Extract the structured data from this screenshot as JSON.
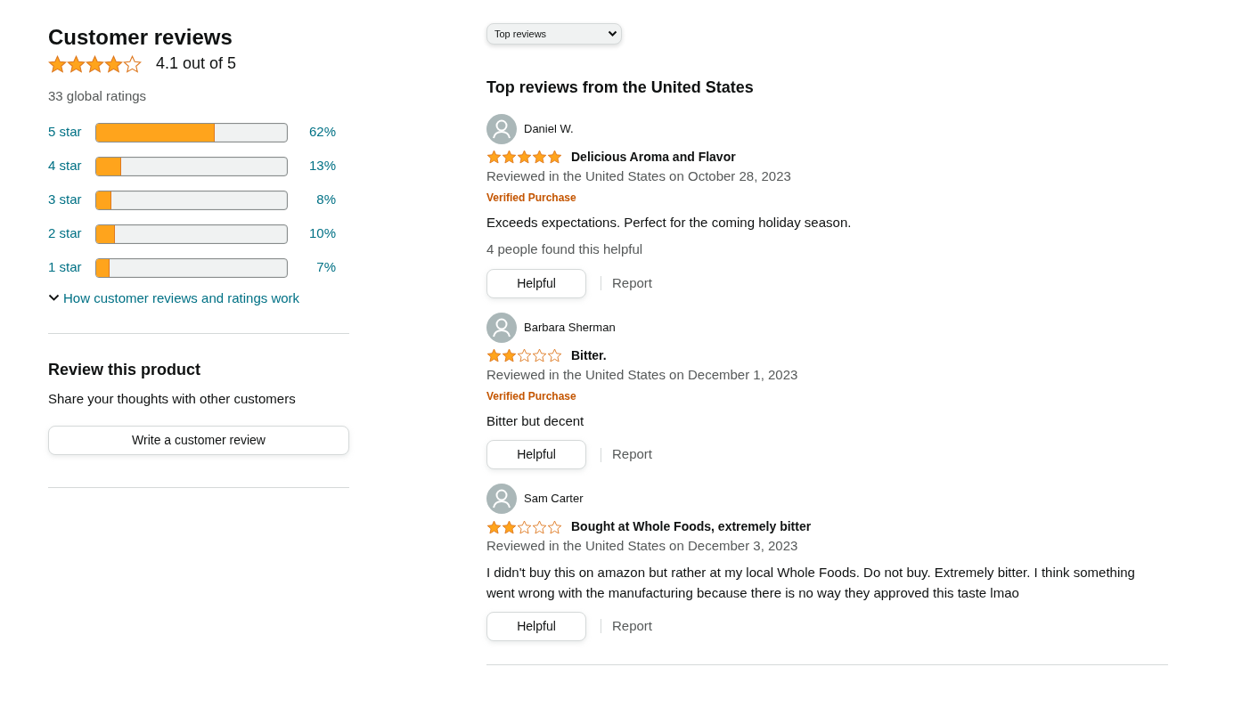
{
  "summary": {
    "title": "Customer reviews",
    "stars": 4,
    "rating": "4.1 out of 5",
    "total": "33 global ratings",
    "histogram": [
      {
        "label": "5 star",
        "level": 0.62,
        "percent": "62%"
      },
      {
        "label": "4 star",
        "level": 0.13,
        "percent": "13%"
      },
      {
        "label": "3 star",
        "level": 0.08,
        "percent": "8%"
      },
      {
        "label": "2 star",
        "level": 0.1,
        "percent": "10%"
      },
      {
        "label": "1 star",
        "level": 0.07,
        "percent": "7%"
      }
    ],
    "how_link": "How customer reviews and ratings work"
  },
  "review_this": {
    "title": "Review this product",
    "subtitle": "Share your thoughts with other customers",
    "button": "Write a customer review"
  },
  "sort": {
    "value": "Top reviews"
  },
  "reviews_heading": "Top reviews from the United States",
  "reviews": [
    {
      "author": "Daniel W.",
      "stars": 5,
      "title": "Delicious Aroma and Flavor",
      "date": "Reviewed in the United States on October 28, 2023",
      "verified": "Verified Purchase",
      "body": "Exceeds expectations. Perfect for the coming holiday season.",
      "helpful_count": "4 people found this helpful",
      "helpful": "Helpful",
      "report": "Report"
    },
    {
      "author": "Barbara Sherman",
      "stars": 2,
      "title": "Bitter.",
      "date": "Reviewed in the United States on December 1, 2023",
      "verified": "Verified Purchase",
      "body": "Bitter but decent",
      "helpful": "Helpful",
      "report": "Report"
    },
    {
      "author": "Sam Carter",
      "stars": 2,
      "title": "Bought at Whole Foods, extremely bitter",
      "date": "Reviewed in the United States on December 3, 2023",
      "body": "I didn't buy this on amazon but rather at my local Whole Foods. Do not buy. Extremely bitter. I think something went wrong with the manufacturing because there is no way they approved this taste lmao",
      "helpful": "Helpful",
      "report": "Report"
    }
  ]
}
